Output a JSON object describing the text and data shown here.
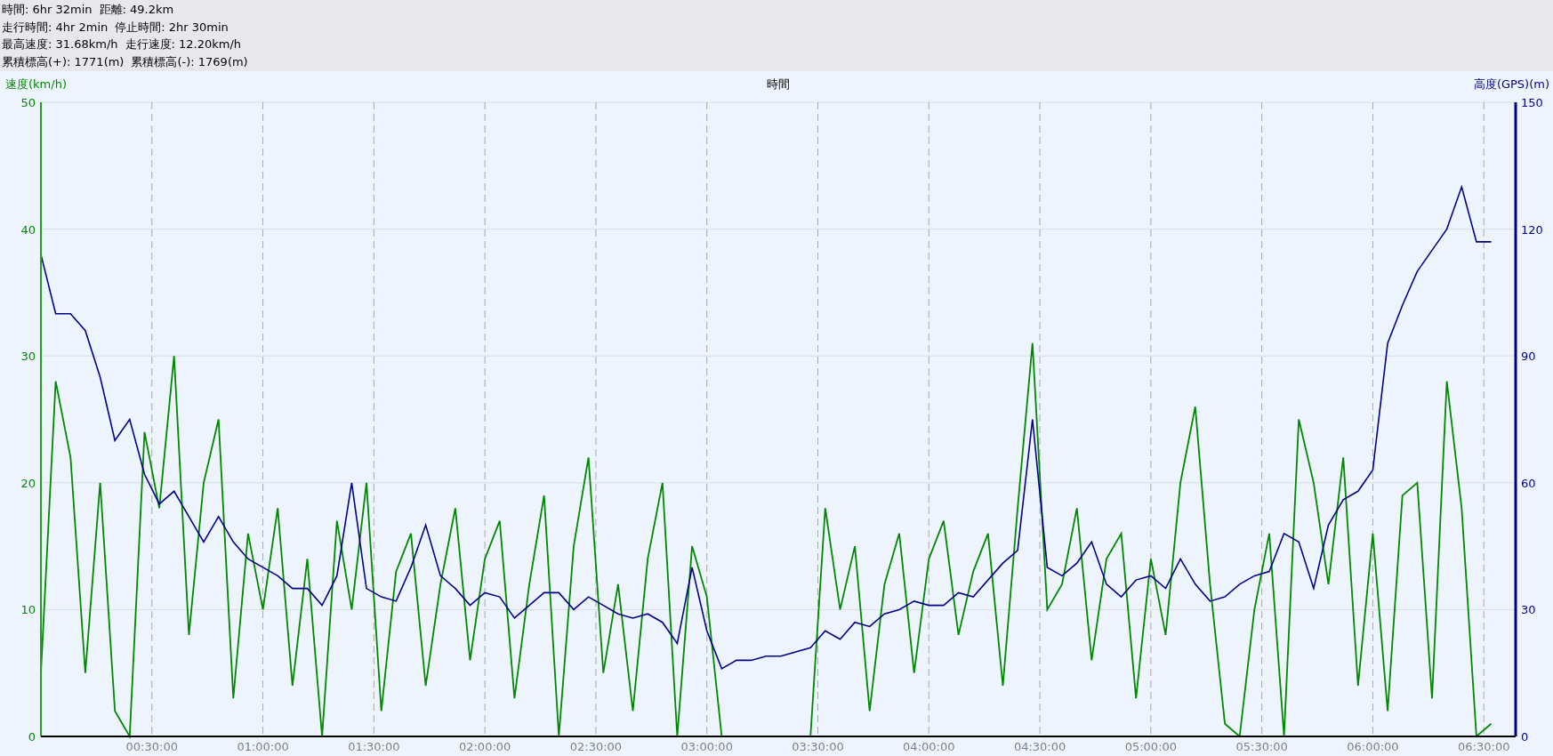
{
  "summary": [
    [
      "時間: 6hr 32min",
      "距離: 49.2km"
    ],
    [
      "走行時間: 4hr 2min",
      "停止時間: 2hr 30min"
    ],
    [
      "最高速度: 31.68km/h",
      "走行速度: 12.20km/h"
    ],
    [
      "累積標高(+): 1771(m)",
      "累積標高(-): 1769(m)"
    ]
  ],
  "chart": {
    "chart_data": {
      "type": "line",
      "title": "時間",
      "ylabel": "速度(km/h)",
      "y2label": "高度(GPS)(m)",
      "x": [
        0,
        4,
        8,
        12,
        16,
        20,
        24,
        28,
        32,
        36,
        40,
        44,
        48,
        52,
        56,
        60,
        64,
        68,
        72,
        76,
        80,
        84,
        88,
        92,
        96,
        100,
        104,
        108,
        112,
        116,
        120,
        124,
        128,
        132,
        136,
        140,
        144,
        148,
        152,
        156,
        160,
        164,
        168,
        172,
        176,
        180,
        184,
        188,
        192,
        196,
        200,
        204,
        208,
        212,
        216,
        220,
        224,
        228,
        232,
        236,
        240,
        244,
        248,
        252,
        256,
        260,
        264,
        268,
        272,
        276,
        280,
        284,
        288,
        292,
        296,
        300,
        304,
        308,
        312,
        316,
        320,
        324,
        328,
        332,
        336,
        340,
        344,
        348,
        352,
        356,
        360,
        364,
        368,
        372,
        376,
        380,
        384,
        388,
        392
      ],
      "grid": true,
      "xlim": [
        0,
        398.6
      ],
      "ylim": [
        0,
        50
      ],
      "y2lim": [
        0,
        150
      ],
      "xticks": [
        {
          "value": 30,
          "label": "00:30:00"
        },
        {
          "value": 60,
          "label": "01:00:00"
        },
        {
          "value": 90,
          "label": "01:30:00"
        },
        {
          "value": 120,
          "label": "02:00:00"
        },
        {
          "value": 150,
          "label": "02:30:00"
        },
        {
          "value": 180,
          "label": "03:00:00"
        },
        {
          "value": 210,
          "label": "03:30:00"
        },
        {
          "value": 240,
          "label": "04:00:00"
        },
        {
          "value": 270,
          "label": "04:30:00"
        },
        {
          "value": 300,
          "label": "05:00:00"
        },
        {
          "value": 330,
          "label": "05:30:00"
        },
        {
          "value": 360,
          "label": "06:00:00"
        },
        {
          "value": 390,
          "label": "06:30:00"
        }
      ],
      "yticks": [
        0,
        10,
        20,
        30,
        40,
        50
      ],
      "y2ticks": [
        0,
        30,
        60,
        90,
        120,
        150
      ],
      "series": [
        {
          "color": "#008800",
          "values": [
            5,
            28,
            22,
            5,
            20,
            2,
            0,
            24,
            18,
            30,
            8,
            20,
            25,
            3,
            16,
            10,
            18,
            4,
            14,
            0,
            17,
            10,
            20,
            2,
            13,
            16,
            4,
            12,
            18,
            6,
            14,
            17,
            3,
            12,
            19,
            0,
            15,
            22,
            5,
            12,
            2,
            14,
            20,
            0,
            15,
            11,
            0,
            0,
            0,
            0,
            0,
            0,
            0,
            18,
            10,
            15,
            2,
            12,
            16,
            5,
            14,
            17,
            8,
            13,
            16,
            4,
            18,
            31,
            10,
            12,
            18,
            6,
            14,
            16,
            3,
            14,
            8,
            20,
            26,
            12,
            1,
            0,
            10,
            16,
            0,
            25,
            20,
            12,
            22,
            4,
            16,
            2,
            19,
            20,
            3,
            28,
            18,
            0,
            1
          ]
        },
        {
          "color": "#000088",
          "axis": "y2",
          "values": [
            114,
            100,
            100,
            96,
            85,
            70,
            75,
            62,
            55,
            58,
            52,
            46,
            52,
            46,
            42,
            40,
            38,
            35,
            35,
            31,
            38,
            60,
            35,
            33,
            32,
            40,
            50,
            38,
            35,
            31,
            34,
            33,
            28,
            31,
            34,
            34,
            30,
            33,
            31,
            29,
            28,
            29,
            27,
            22,
            40,
            25,
            16,
            18,
            18,
            19,
            19,
            20,
            21,
            25,
            23,
            27,
            26,
            29,
            30,
            32,
            31,
            31,
            34,
            33,
            37,
            41,
            44,
            75,
            40,
            38,
            41,
            46,
            36,
            33,
            37,
            38,
            35,
            42,
            36,
            32,
            33,
            36,
            38,
            39,
            48,
            46,
            35,
            50,
            56,
            58,
            63,
            93,
            102,
            110,
            115,
            120,
            130,
            117,
            117
          ]
        }
      ]
    }
  }
}
